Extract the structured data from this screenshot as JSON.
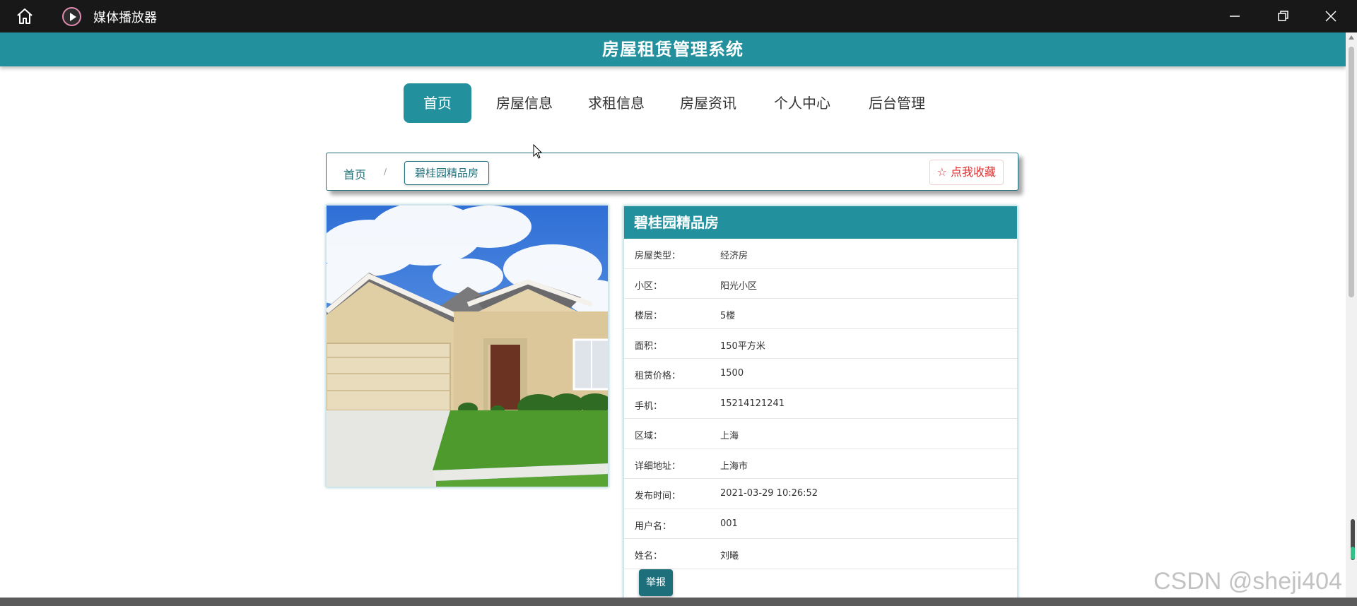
{
  "window": {
    "app_title": "媒体播放器",
    "icons": [
      "home-icon",
      "play-icon",
      "minimize-icon",
      "restore-icon",
      "close-icon"
    ]
  },
  "site": {
    "title": "房屋租赁管理系统",
    "accent_color": "#23909e"
  },
  "nav": {
    "items": [
      {
        "label": "首页",
        "active": true
      },
      {
        "label": "房屋信息",
        "active": false
      },
      {
        "label": "求租信息",
        "active": false
      },
      {
        "label": "房屋资讯",
        "active": false
      },
      {
        "label": "个人中心",
        "active": false
      },
      {
        "label": "后台管理",
        "active": false
      }
    ]
  },
  "breadcrumb": {
    "home": "首页",
    "separator": "/",
    "current": "碧桂园精品房",
    "favorite_label": "☆ 点我收藏"
  },
  "detail": {
    "title": "碧桂园精品房",
    "rows": [
      {
        "label": "房屋类型：",
        "value": "经济房"
      },
      {
        "label": "小区：",
        "value": "阳光小区"
      },
      {
        "label": "楼层：",
        "value": "5楼"
      },
      {
        "label": "面积：",
        "value": "150平方米"
      },
      {
        "label": "租赁价格：",
        "value": "1500"
      },
      {
        "label": "手机：",
        "value": "15214121241"
      },
      {
        "label": "区域：",
        "value": "上海"
      },
      {
        "label": "详细地址：",
        "value": "上海市"
      },
      {
        "label": "发布时间：",
        "value": "2021-03-29 10:26:52"
      },
      {
        "label": "用户名：",
        "value": "001"
      },
      {
        "label": "姓名：",
        "value": "刘曦"
      }
    ],
    "report_label": "举报"
  },
  "watermark": "CSDN @sheji404"
}
